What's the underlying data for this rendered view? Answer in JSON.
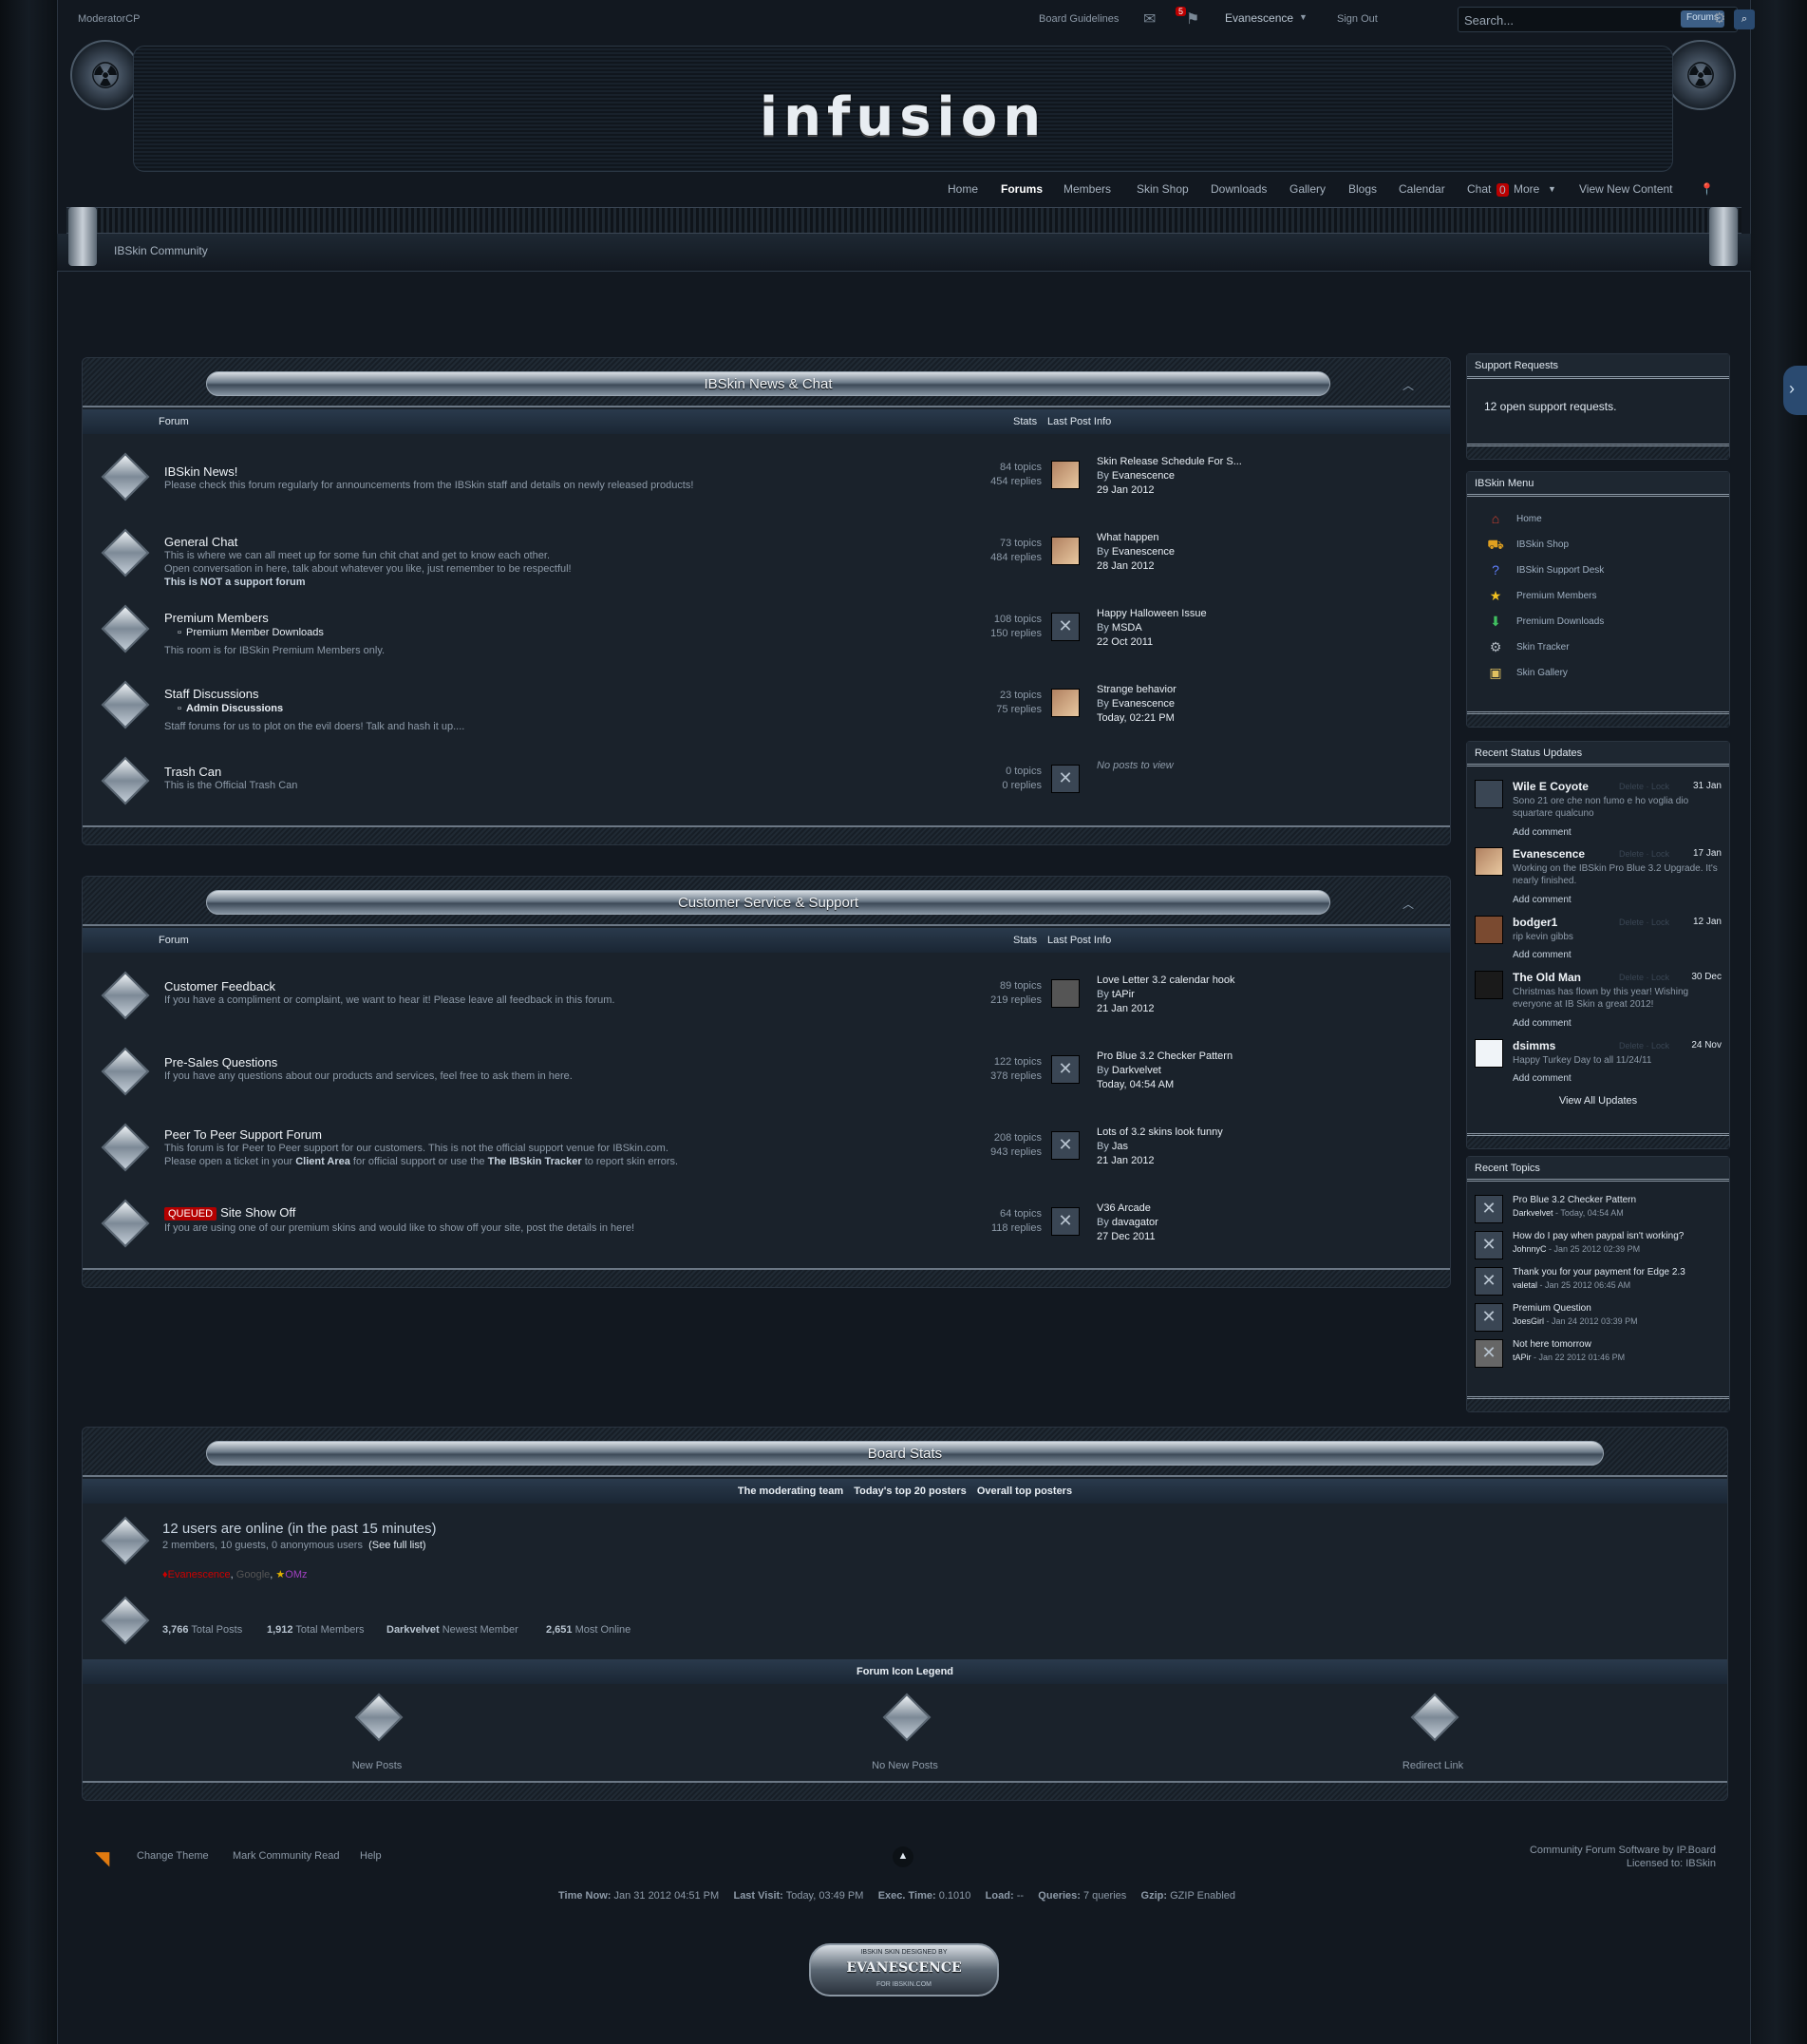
{
  "topbar": {
    "moderator": "ModeratorCP",
    "guidelines": "Board Guidelines",
    "msg_count": "5",
    "user": "Evanescence",
    "signout": "Sign Out",
    "search_placeholder": "Search...",
    "search_scope": "Forums"
  },
  "logo": "infusion",
  "nav": {
    "home": "Home",
    "forums": "Forums",
    "members": "Members",
    "skinshop": "Skin Shop",
    "downloads": "Downloads",
    "gallery": "Gallery",
    "blogs": "Blogs",
    "calendar": "Calendar",
    "chat": "Chat",
    "chat_count": "0",
    "more": "More",
    "newcontent": "View New Content"
  },
  "breadcrumb": "IBSkin Community",
  "col_forum": "Forum",
  "col_stats": "Stats",
  "col_last": "Last Post Info",
  "cat1": {
    "title": "IBSkin News & Chat",
    "forums": [
      {
        "name": "IBSkin News!",
        "desc": "Please check this forum regularly for announcements from the IBSkin staff and details on newly released products!",
        "topics": "84 topics",
        "replies": "454 replies",
        "last_title": "Skin Release Schedule For S...",
        "by": "By",
        "last_user": "Evanescence",
        "last_date": "29 Jan 2012"
      },
      {
        "name": "General Chat",
        "desc": "This is where we can all meet up for some fun chit chat and get to know each other.",
        "desc2": "Open conversation in here, talk about whatever you like, just remember to be respectful!",
        "desc3": "This is NOT a support forum",
        "topics": "73 topics",
        "replies": "484 replies",
        "last_title": "What happen",
        "by": "By",
        "last_user": "Evanescence",
        "last_date": "28 Jan 2012"
      },
      {
        "name": "Premium Members",
        "sub": "Premium Member Downloads",
        "desc": "This room is for IBSkin Premium Members only.",
        "topics": "108 topics",
        "replies": "150 replies",
        "last_title": "Happy Halloween Issue",
        "by": "By",
        "last_user": "MSDA",
        "last_date": "22 Oct 2011"
      },
      {
        "name": "Staff Discussions",
        "sub": "Admin Discussions",
        "desc": "Staff forums for us to plot on the evil doers! Talk and hash it up....",
        "topics": "23 topics",
        "replies": "75 replies",
        "last_title": "Strange behavior",
        "by": "By",
        "last_user": "Evanescence",
        "last_date": "Today, 02:21 PM"
      },
      {
        "name": "Trash Can",
        "desc": "This is the Official Trash Can",
        "topics": "0 topics",
        "replies": "0 replies",
        "last_empty": "No posts to view"
      }
    ]
  },
  "cat2": {
    "title": "Customer Service & Support",
    "forums": [
      {
        "name": "Customer Feedback",
        "desc": "If you have a compliment or complaint, we want to hear it! Please leave all feedback in this forum.",
        "topics": "89 topics",
        "replies": "219 replies",
        "last_title": "Love Letter 3.2 calendar hook",
        "by": "By",
        "last_user": "tAPir",
        "last_date": "21 Jan 2012"
      },
      {
        "name": "Pre-Sales Questions",
        "desc": "If you have any questions about our products and services, feel free to ask them in here.",
        "topics": "122 topics",
        "replies": "378 replies",
        "last_title": "Pro Blue 3.2 Checker Pattern",
        "by": "By",
        "last_user": "Darkvelvet",
        "last_date": "Today, 04:54 AM"
      },
      {
        "name": "Peer To Peer Support Forum",
        "desc": "This forum is for Peer to Peer support for our customers. This is not the official support venue for IBSkin.com.",
        "desc2a": "Please open a ticket in your ",
        "desc2b": "Client Area",
        "desc2c": " for official support or use the ",
        "desc2d": "The IBSkin Tracker",
        "desc2e": " to report skin errors.",
        "topics": "208 topics",
        "replies": "943 replies",
        "last_title": "Lots of 3.2 skins look funny",
        "by": "By",
        "last_user": "Jas",
        "last_date": "21 Jan 2012"
      },
      {
        "name": "Site Show Off",
        "queued": "QUEUED",
        "desc": "If you are using one of our premium skins and would like to show off your site, post the details in here!",
        "topics": "64 topics",
        "replies": "118 replies",
        "last_title": "V36 Arcade",
        "by": "By",
        "last_user": "davagator",
        "last_date": "27 Dec 2011"
      }
    ]
  },
  "sidebar": {
    "support": {
      "title": "Support Requests",
      "text": "12 open support requests."
    },
    "menu": {
      "title": "IBSkin Menu",
      "items": [
        "Home",
        "IBSkin Shop",
        "IBSkin Support Desk",
        "Premium Members",
        "Premium Downloads",
        "Skin Tracker",
        "Skin Gallery"
      ]
    },
    "status": {
      "title": "Recent Status Updates",
      "delete": "Delete",
      "lock": "Lock",
      "add": "Add comment",
      "view_all": "View All Updates",
      "items": [
        {
          "name": "Wile E Coyote",
          "date": "31 Jan",
          "text": "Sono 21 ore che non fumo e ho voglia dio squartare qualcuno"
        },
        {
          "name": "Evanescence",
          "date": "17 Jan",
          "text": "Working on the IBSkin Pro Blue 3.2 Upgrade. It's nearly finished."
        },
        {
          "name": "bodger1",
          "date": "12 Jan",
          "text": "rip kevin gibbs"
        },
        {
          "name": "The Old Man",
          "date": "30 Dec",
          "text": "Christmas has flown by this year! Wishing everyone at IB Skin a great 2012!"
        },
        {
          "name": "dsimms",
          "date": "24 Nov",
          "text": "Happy Turkey Day to all 11/24/11"
        }
      ]
    },
    "topics": {
      "title": "Recent Topics",
      "items": [
        {
          "title": "Pro Blue 3.2 Checker Pattern",
          "user": "Darkvelvet",
          "date": " - Today, 04:54 AM"
        },
        {
          "title": "How do I pay when paypal isn't working?",
          "user": "JohnnyC",
          "date": " - Jan 25 2012 02:39 PM"
        },
        {
          "title": "Thank you for your payment for Edge 2.3",
          "user": "valetal",
          "date": " - Jan 25 2012 06:45 AM"
        },
        {
          "title": "Premium Question",
          "user": "JoesGirl",
          "date": " - Jan 24 2012 03:39 PM"
        },
        {
          "title": "Not here tomorrow",
          "user": "tAPir",
          "date": " - Jan 22 2012 01:46 PM"
        }
      ]
    }
  },
  "stats": {
    "title": "Board Stats",
    "links": [
      "The moderating team",
      "Today's top 20 posters",
      "Overall top posters"
    ],
    "online_title": "12 users are online (in the past 15 minutes)",
    "online_sub": "2 members, 10 guests, 0 anonymous users",
    "full_list": "(See full list)",
    "online_users": [
      "Evanescence",
      "Google",
      "OMz"
    ],
    "total_posts": "3,766",
    "total_posts_lbl": "Total Posts",
    "total_members": "1,912",
    "total_members_lbl": "Total Members",
    "newest": "Darkvelvet",
    "newest_lbl": "Newest Member",
    "most_online": "2,651",
    "most_online_lbl": "Most Online",
    "legend_title": "Forum Icon Legend",
    "legend": [
      "New Posts",
      "No New Posts",
      "Redirect Link"
    ]
  },
  "footer": {
    "change_theme": "Change Theme",
    "mark_read": "Mark Community Read",
    "help": "Help",
    "credit1": "Community Forum Software by IP.Board",
    "credit2": "Licensed to: IBSkin",
    "time_now_lbl": "Time Now:",
    "time_now": "Jan 31 2012 04:51 PM",
    "last_visit_lbl": "Last Visit:",
    "last_visit": "Today, 03:49 PM",
    "exec_lbl": "Exec. Time:",
    "exec": "0.1010",
    "load_lbl": "Load:",
    "load": "--",
    "queries_lbl": "Queries:",
    "queries": "7 queries",
    "gzip_lbl": "Gzip:",
    "gzip": "GZIP Enabled",
    "designer_top": "IBSKIN SKIN DESIGNED BY",
    "designer": "EVANESCENCE",
    "designer_bottom": "FOR IBSKIN.COM"
  }
}
